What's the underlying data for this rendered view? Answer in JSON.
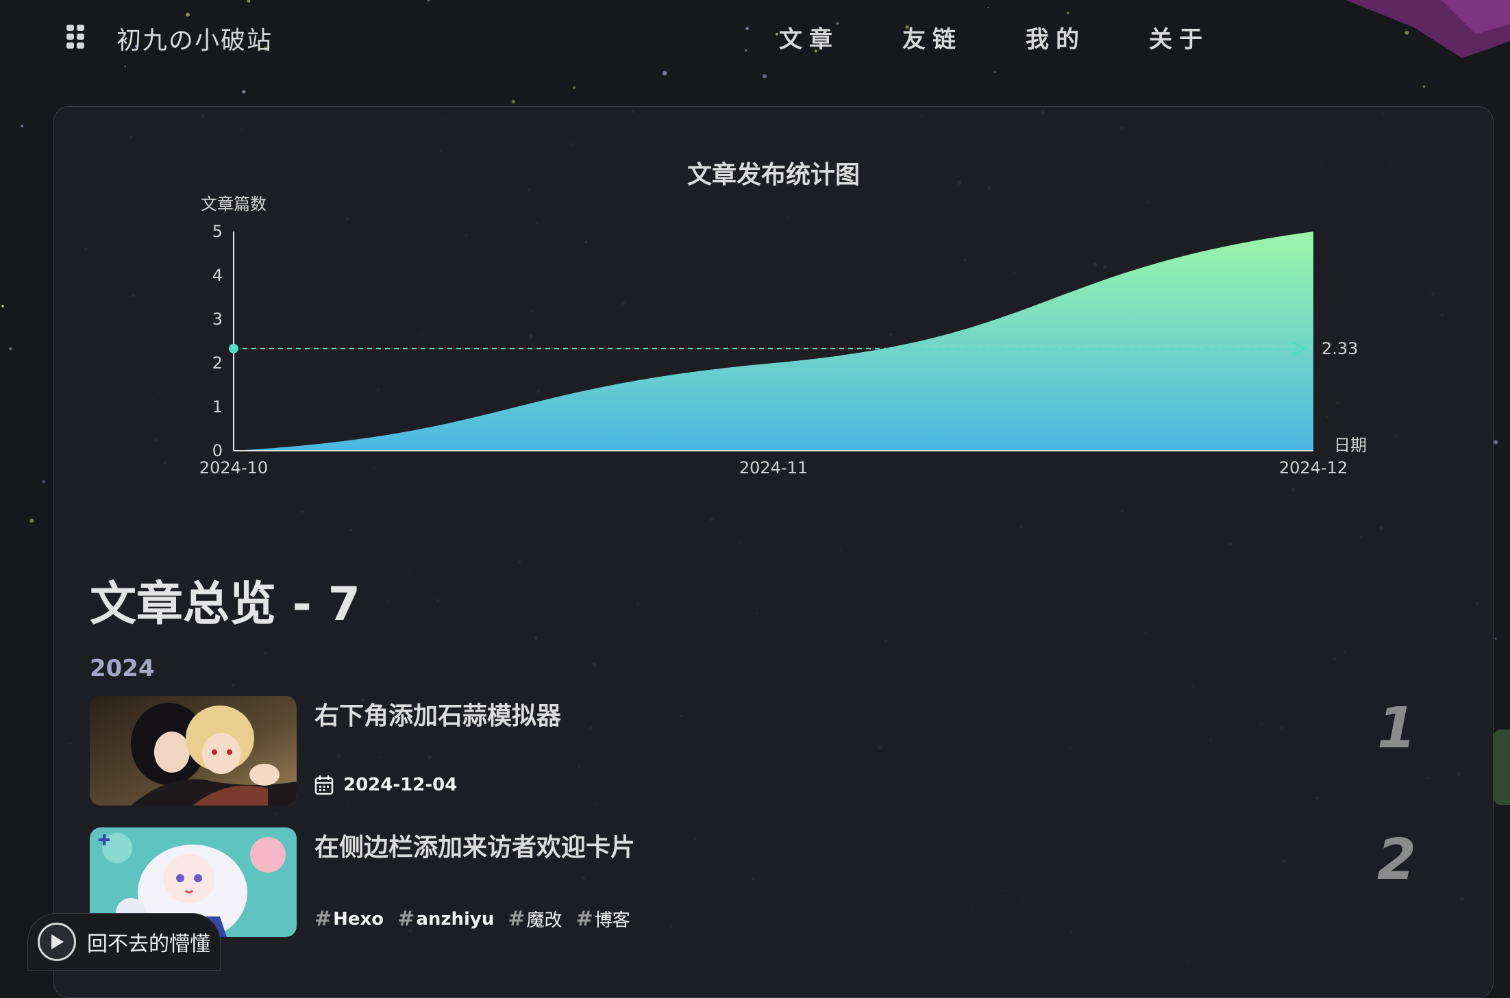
{
  "header": {
    "site_title": "初九の小破站",
    "nav": [
      {
        "label": "文章"
      },
      {
        "label": "友链"
      },
      {
        "label": "我的"
      },
      {
        "label": "关于"
      }
    ]
  },
  "chart_data": {
    "type": "area",
    "title": "文章发布统计图",
    "xlabel": "日期",
    "ylabel": "文章篇数",
    "x": [
      "2024-10",
      "2024-11",
      "2024-12"
    ],
    "values": [
      0,
      2,
      5
    ],
    "ylim": [
      0,
      5
    ],
    "yticks": [
      0,
      1,
      2,
      3,
      4,
      5
    ],
    "markline": {
      "value": 2.33,
      "label": "2.33"
    },
    "colors": {
      "top": "#9cf7a9",
      "bottom": "#4bb7e3",
      "markline": "#4fe0c3"
    }
  },
  "overview": {
    "title": "文章总览 - 7",
    "year": "2024"
  },
  "posts": [
    {
      "title": "右下角添加石蒜模拟器",
      "date": "2024-12-04",
      "number": "1"
    },
    {
      "title": "在侧边栏添加来访者欢迎卡片",
      "tags": [
        "Hexo",
        "anzhiyu",
        "魔改",
        "博客"
      ],
      "number": "2"
    }
  ],
  "player": {
    "song": "回不去的懵懂"
  }
}
